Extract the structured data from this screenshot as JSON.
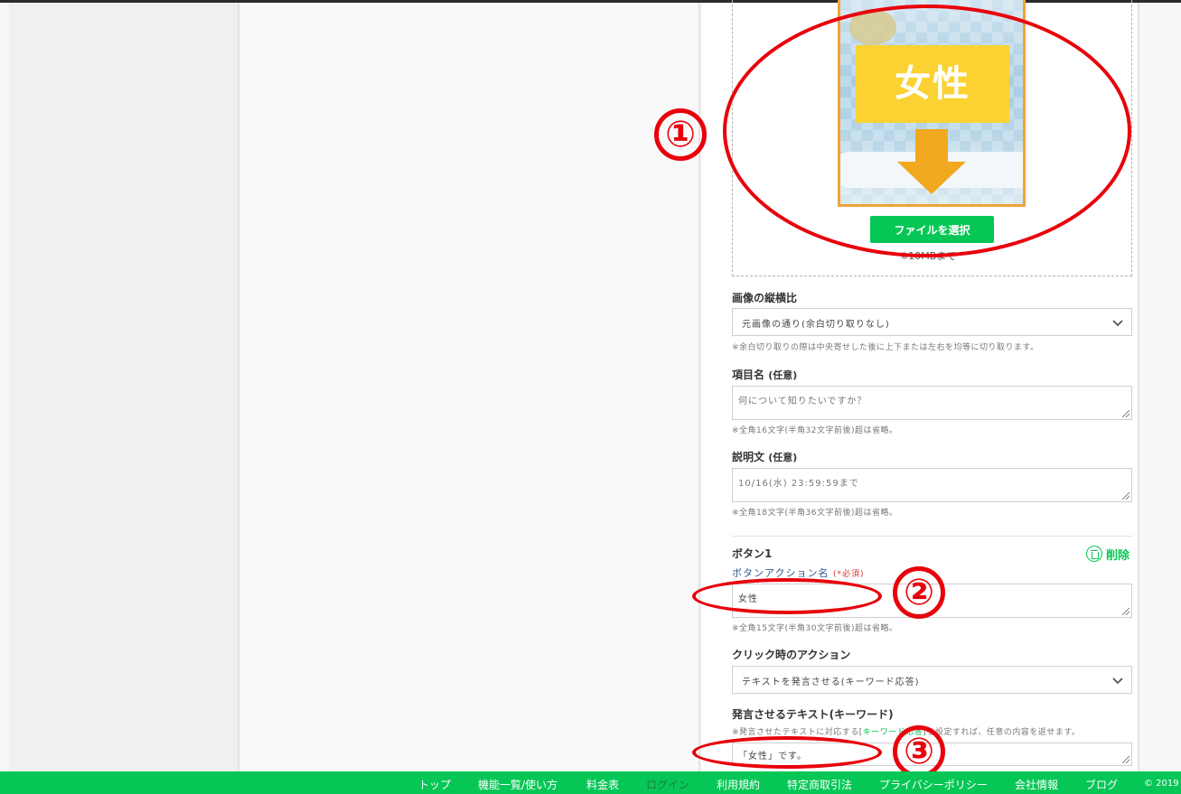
{
  "upload": {
    "thumbnail_text": "女性",
    "file_button": "ファイルを選択",
    "file_note": "※10MBまで"
  },
  "aspect": {
    "label": "画像の縦横比",
    "selected": "元画像の通り(余白切り取りなし)",
    "note": "※余白切り取りの際は中央寄せした後に上下または左右を均等に切り取ります。"
  },
  "item_name": {
    "label": "項目名",
    "optional": "(任意)",
    "placeholder": "何について知りたいですか？",
    "note": "※全角16文字(半角32文字前後)超は省略。"
  },
  "description": {
    "label": "説明文",
    "optional": "(任意)",
    "placeholder": "10/16(水) 23:59:59まで",
    "note": "※全角18文字(半角36文字前後)超は省略。"
  },
  "button1": {
    "title": "ボタン1",
    "delete_label": "削除",
    "action_name_label": "ボタンアクション名",
    "required": "(*必須)",
    "action_name_value": "女性",
    "action_name_note": "※全角15文字(半角30文字前後)超は省略。",
    "click_action_label": "クリック時のアクション",
    "click_action_selected": "テキストを発言させる(キーワード応答)",
    "speech_label": "発言させるテキスト(キーワード)",
    "speech_note_prefix": "※発言させたテキストに対応する[",
    "speech_note_link": "キーワード応答",
    "speech_note_suffix": "]を設定すれば、任意の内容を返せます。",
    "speech_value": "「女性」です。"
  },
  "annotations": {
    "one": "①",
    "two": "②",
    "three": "③",
    "color": "#e8000b"
  },
  "footer": {
    "links": [
      "トップ",
      "機能一覧/使い方",
      "料金表",
      "ログイン",
      "利用規約",
      "特定商取引法",
      "プライバシーポリシー",
      "会社情報",
      "ブログ"
    ],
    "copyright": "© 2019",
    "background": "#06c755"
  }
}
